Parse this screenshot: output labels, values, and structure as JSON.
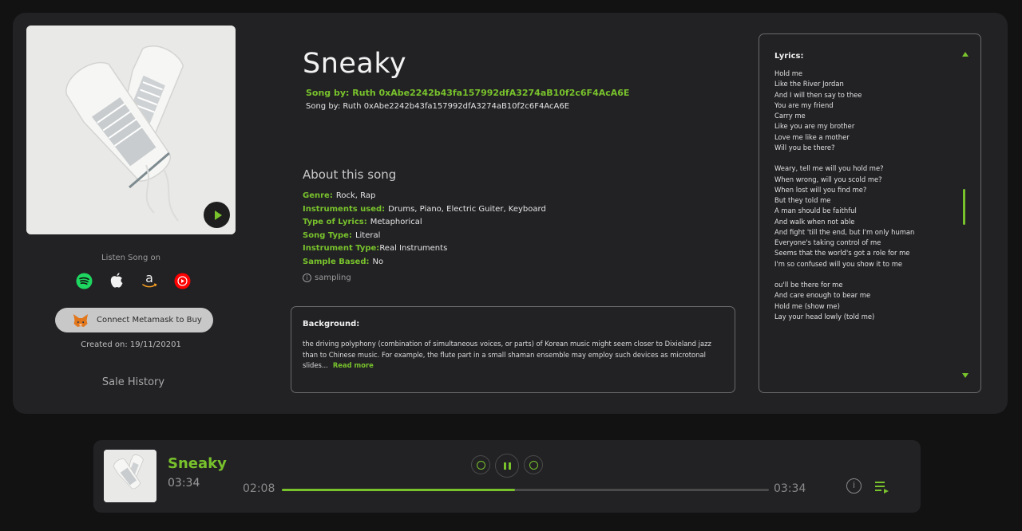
{
  "song": {
    "title": "Sneaky",
    "by_green": "Song by: Ruth 0xAbe2242b43fa157992dfA3274aB10f2c6F4AcA6E",
    "by_white": "Song by: Ruth 0xAbe2242b43fa157992dfA3274aB10f2c6F4AcA6E"
  },
  "left": {
    "listen_label": "Listen Song on",
    "platforms": [
      "spotify-icon",
      "apple-icon",
      "amazon-icon",
      "youtube-music-icon"
    ],
    "metamask_label": "Connect Metamask to Buy",
    "created": "Created on: 19/11/20201",
    "sale_history": "Sale History"
  },
  "about": {
    "title": "About this song",
    "genre_k": "Genre:",
    "genre_v": "Rock, Rap",
    "instruments_k": "Instruments used:",
    "instruments_v": "Drums, Piano, Electric Guiter, Keyboard",
    "lyrics_type_k": "Type of Lyrics:",
    "lyrics_type_v": "Metaphorical",
    "song_type_k": "Song Type:",
    "song_type_v": "Literal",
    "instrument_type_k": "Instrument Type:",
    "instrument_type_v": "Real Instruments",
    "sample_k": "Sample Based:",
    "sample_v": "No",
    "sampling": "sampling"
  },
  "background": {
    "title": "Background:",
    "text": "the driving polyphony (combination of simultaneous voices, or parts) of Korean music might seem closer to Dixieland jazz than to Chinese music. For example, the flute part in a small shaman ensemble may employ such devices as microtonal slides...",
    "read_more": "Read more"
  },
  "lyrics": {
    "title": "Lyrics:",
    "lines": [
      "Hold me",
      "Like the River Jordan",
      "And I will then say to thee",
      "You are my friend",
      "Carry me",
      "Like you are my brother",
      "Love me like a mother",
      "Will you be there?",
      "",
      "Weary, tell me will you hold me?",
      "When wrong, will you scold me?",
      "When lost will you find me?",
      "But they told me",
      "A man should be faithful",
      "And walk when not able",
      "And fight 'till the end, but I'm only human",
      "Everyone's taking control of me",
      "Seems that the world's got a role for me",
      "I'm so confused will you show it to me",
      "",
      "ou'll be there for me",
      "And care enough to bear me",
      "Hold me (show me)",
      "Lay your head lowly (told me)"
    ]
  },
  "player": {
    "title": "Sneaky",
    "duration": "03:34",
    "current_time": "02:08",
    "total_time": "03:34",
    "progress": 0.478,
    "info_glyph": "i"
  },
  "colors": {
    "accent": "#78c22c",
    "card": "#222124",
    "background": "#121212"
  }
}
